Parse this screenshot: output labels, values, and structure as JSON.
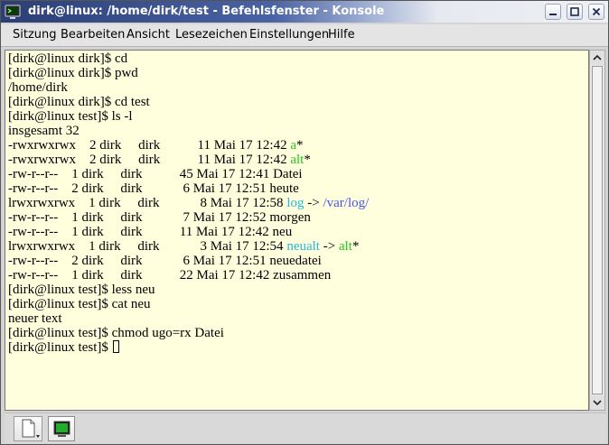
{
  "window": {
    "title": "dirk@linux: /home/dirk/test - Befehlsfenster - Konsole",
    "title_bar_icon": "konsole-icon",
    "buttons": [
      "minimize-icon",
      "maximize-icon",
      "close-icon"
    ]
  },
  "menubar": {
    "items": [
      "Sitzung",
      "Bearbeiten",
      "Ansicht",
      "Lesezeichen",
      "Einstellungen",
      "Hilfe"
    ]
  },
  "terminal": {
    "background_color": "#ffffdd",
    "colors": {
      "executable": "#22c81e",
      "symlink": "#22b9d8",
      "directory": "#4a55e8"
    },
    "lines": [
      [
        {
          "t": "[dirk@linux dirk]$ cd"
        }
      ],
      [
        {
          "t": "[dirk@linux dirk]$ pwd"
        }
      ],
      [
        {
          "t": "/home/dirk"
        }
      ],
      [
        {
          "t": "[dirk@linux dirk]$ cd test"
        }
      ],
      [
        {
          "t": "[dirk@linux test]$ ls -l"
        }
      ],
      [
        {
          "t": "insgesamt 32"
        }
      ],
      [
        {
          "t": "-rwxrwxrwx    2 dirk     dirk           11 Mai 17 12:42 "
        },
        {
          "t": "a",
          "c": "green"
        },
        {
          "t": "*"
        }
      ],
      [
        {
          "t": "-rwxrwxrwx    2 dirk     dirk           11 Mai 17 12:42 "
        },
        {
          "t": "alt",
          "c": "green"
        },
        {
          "t": "*"
        }
      ],
      [
        {
          "t": "-rw-r--r--    1 dirk     dirk           45 Mai 17 12:41 Datei"
        }
      ],
      [
        {
          "t": "-rw-r--r--    2 dirk     dirk            6 Mai 17 12:51 heute"
        }
      ],
      [
        {
          "t": "lrwxrwxrwx    1 dirk     dirk            8 Mai 17 12:58 "
        },
        {
          "t": "log",
          "c": "cyan"
        },
        {
          "t": " -> "
        },
        {
          "t": "/var/log/",
          "c": "blue"
        }
      ],
      [
        {
          "t": "-rw-r--r--    1 dirk     dirk            7 Mai 17 12:52 morgen"
        }
      ],
      [
        {
          "t": "-rw-r--r--    1 dirk     dirk           11 Mai 17 12:42 neu"
        }
      ],
      [
        {
          "t": "lrwxrwxrwx    1 dirk     dirk            3 Mai 17 12:54 "
        },
        {
          "t": "neualt",
          "c": "cyan"
        },
        {
          "t": " -> "
        },
        {
          "t": "alt",
          "c": "green"
        },
        {
          "t": "*"
        }
      ],
      [
        {
          "t": "-rw-r--r--    2 dirk     dirk            6 Mai 17 12:51 neuedatei"
        }
      ],
      [
        {
          "t": "-rw-r--r--    1 dirk     dirk           22 Mai 17 12:42 zusammen"
        }
      ],
      [
        {
          "t": "[dirk@linux test]$ less neu"
        }
      ],
      [
        {
          "t": "[dirk@linux test]$ cat neu"
        }
      ],
      [
        {
          "t": "neuer text"
        }
      ],
      [
        {
          "t": "[dirk@linux test]$ chmod ugo=rx Datei"
        }
      ],
      [
        {
          "t": "[dirk@linux test]$ "
        },
        {
          "cursor": true
        }
      ]
    ]
  },
  "scrollbar": {
    "icons": [
      "scroll-up-arrow-icon",
      "scroll-down-arrow-icon"
    ]
  },
  "tabbar": {
    "new_session_icon": "new-session-icon",
    "session_tab_icon": "terminal-session-icon"
  }
}
